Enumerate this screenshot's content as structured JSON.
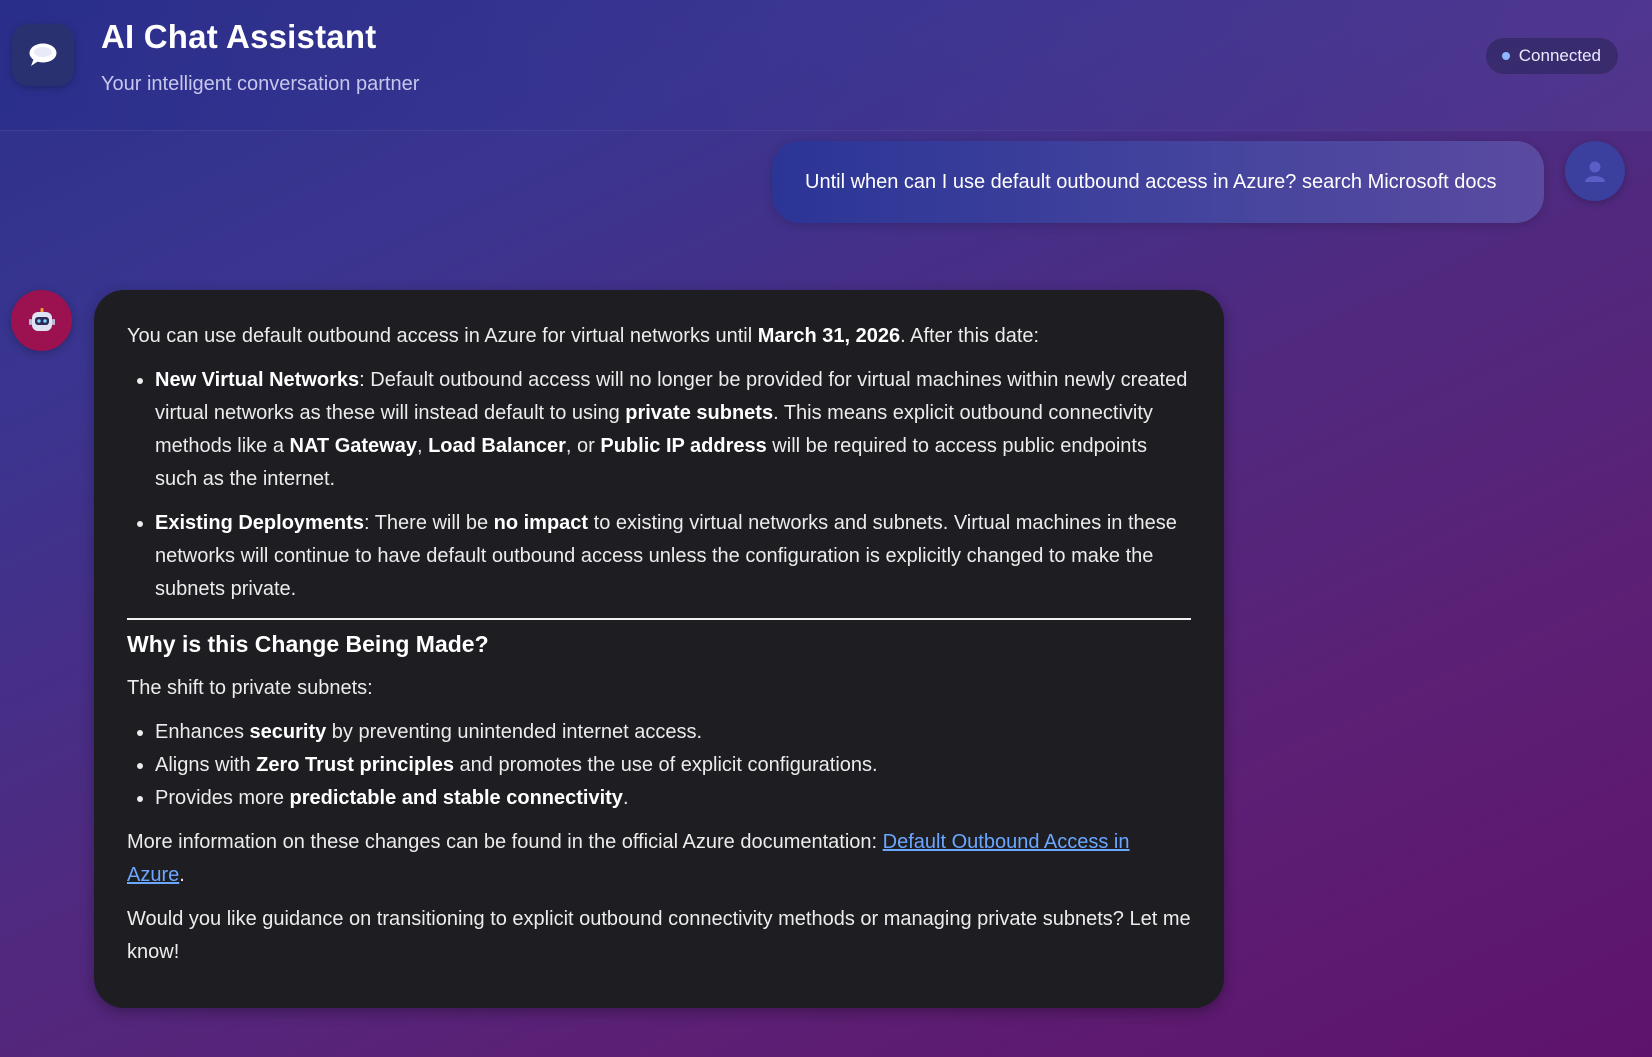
{
  "header": {
    "title": "AI Chat Assistant",
    "subtitle": "Your intelligent conversation partner",
    "status": "Connected",
    "logo_icon": "chat-bubble-icon"
  },
  "colors": {
    "status_dot": "#8fb7ff",
    "bot_avatar": "#9c1150",
    "user_avatar": "#3b3f9e",
    "bot_bubble": "#1e1d22",
    "link": "#6aa7ff"
  },
  "messages": {
    "user": {
      "text": "Until when can I use default outbound access in Azure? search Microsoft docs",
      "avatar_icon": "user-icon"
    },
    "assistant": {
      "avatar_icon": "robot-icon",
      "intro": {
        "a": "You can use default outbound access in Azure for virtual networks until ",
        "date": "March 31, 2026",
        "b": ". After this date:"
      },
      "bullets": [
        {
          "title": "New Virtual Networks",
          "t1": ": Default outbound access will no longer be provided for virtual machines within newly created virtual networks as these will instead default to using ",
          "b1": "private subnets",
          "t2": ". This means explicit outbound connectivity methods like a ",
          "b2": "NAT Gateway",
          "t3": ", ",
          "b3": "Load Balancer",
          "t4": ", or ",
          "b4": "Public IP address",
          "t5": " will be required to access public endpoints such as the internet."
        },
        {
          "title": "Existing Deployments",
          "t1": ": There will be ",
          "b1": "no impact",
          "t2": " to existing virtual networks and subnets. Virtual machines in these networks will continue to have default outbound access unless the configuration is explicitly changed to make the subnets private."
        }
      ],
      "heading": "Why is this Change Being Made?",
      "shift_intro": "The shift to private subnets:",
      "reasons": [
        {
          "pre": "Enhances ",
          "bold": "security",
          "post": " by preventing unintended internet access."
        },
        {
          "pre": "Aligns with ",
          "bold": "Zero Trust principles",
          "post": " and promotes the use of explicit configurations."
        },
        {
          "pre": "Provides more ",
          "bold": "predictable and stable connectivity",
          "post": "."
        }
      ],
      "more_info": {
        "pre": "More information on these changes can be found in the official Azure documentation: ",
        "link_text": "Default Outbound Access in Azure",
        "post": "."
      },
      "closing": "Would you like guidance on transitioning to explicit outbound connectivity methods or managing private subnets? Let me know!"
    }
  }
}
